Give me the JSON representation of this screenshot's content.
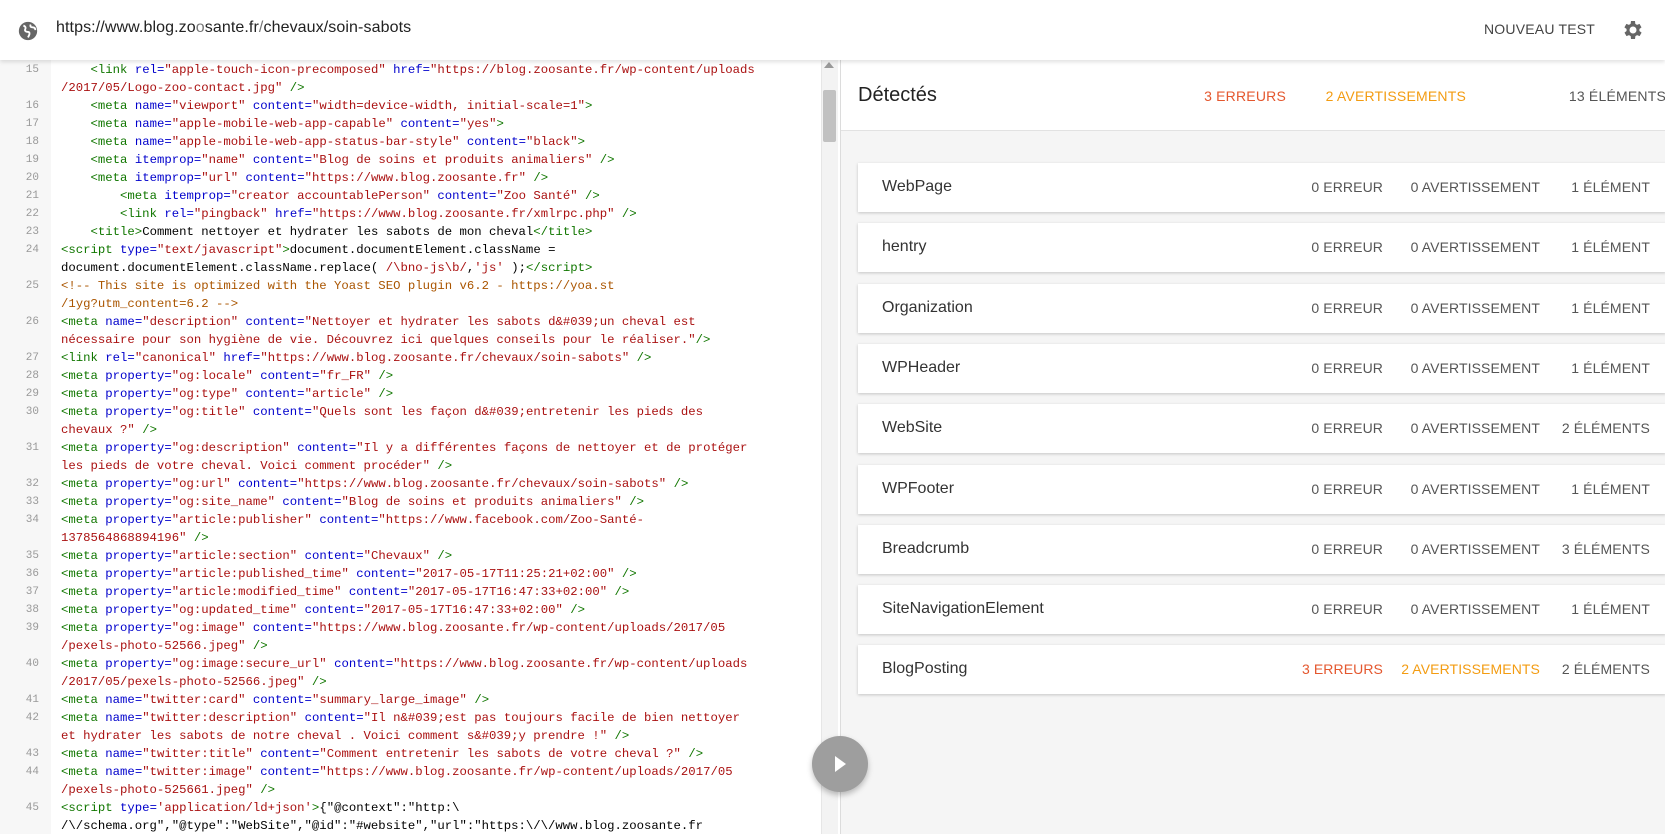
{
  "topbar": {
    "url_host_start": "https://www.blog.zo",
    "url_host_dim": "o",
    "url_host_end": "sante.fr",
    "url_path_dim": "/",
    "url_path": "chevaux/soin-sabots",
    "new_test_label": "NOUVEAU TEST",
    "globe_icon": "globe-icon",
    "settings_icon": "gear-icon"
  },
  "editor": {
    "lines": [
      {
        "n": "15",
        "html": "    <span class=\"t\">&lt;link</span> <span class=\"a\">rel=</span><span class=\"s\">\"apple-touch-icon-precomposed\"</span> <span class=\"a\">href=</span><span class=\"s\">\"https://blog.zoosante.fr/wp-content/uploads</span>"
      },
      {
        "n": "",
        "html": "<span class=\"s\">/2017/05/Logo-zoo-contact.jpg\"</span> <span class=\"t\">/&gt;</span>"
      },
      {
        "n": "16",
        "html": "    <span class=\"t\">&lt;meta</span> <span class=\"a\">name=</span><span class=\"s\">\"viewport\"</span> <span class=\"a\">content=</span><span class=\"s\">\"width=device-width, initial-scale=1\"</span><span class=\"t\">&gt;</span>"
      },
      {
        "n": "17",
        "html": "    <span class=\"t\">&lt;meta</span> <span class=\"a\">name=</span><span class=\"s\">\"apple-mobile-web-app-capable\"</span> <span class=\"a\">content=</span><span class=\"s\">\"yes\"</span><span class=\"t\">&gt;</span>"
      },
      {
        "n": "18",
        "html": "    <span class=\"t\">&lt;meta</span> <span class=\"a\">name=</span><span class=\"s\">\"apple-mobile-web-app-status-bar-style\"</span> <span class=\"a\">content=</span><span class=\"s\">\"black\"</span><span class=\"t\">&gt;</span>"
      },
      {
        "n": "19",
        "html": "    <span class=\"t\">&lt;meta</span> <span class=\"a\">itemprop=</span><span class=\"s\">\"name\"</span> <span class=\"a\">content=</span><span class=\"s\">\"Blog de soins et produits animaliers\"</span> <span class=\"t\">/&gt;</span>"
      },
      {
        "n": "20",
        "html": "    <span class=\"t\">&lt;meta</span> <span class=\"a\">itemprop=</span><span class=\"s\">\"url\"</span> <span class=\"a\">content=</span><span class=\"s\">\"https://www.blog.zoosante.fr\"</span> <span class=\"t\">/&gt;</span>"
      },
      {
        "n": "21",
        "html": "        <span class=\"t\">&lt;meta</span> <span class=\"a\">itemprop=</span><span class=\"s\">\"creator accountablePerson\"</span> <span class=\"a\">content=</span><span class=\"s\">\"Zoo Santé\"</span> <span class=\"t\">/&gt;</span>"
      },
      {
        "n": "22",
        "html": "        <span class=\"t\">&lt;link</span> <span class=\"a\">rel=</span><span class=\"s\">\"pingback\"</span> <span class=\"a\">href=</span><span class=\"s\">\"https://www.blog.zoosante.fr/xmlrpc.php\"</span> <span class=\"t\">/&gt;</span>"
      },
      {
        "n": "23",
        "html": "    <span class=\"t\">&lt;title&gt;</span>Comment nettoyer et hydrater les sabots de mon cheval<span class=\"t\">&lt;/title&gt;</span>"
      },
      {
        "n": "24",
        "html": "<span class=\"t\">&lt;script</span> <span class=\"a\">type=</span><span class=\"s\">\"text/javascript\"</span><span class=\"t\">&gt;</span>document.documentElement.className ="
      },
      {
        "n": "",
        "html": "document.documentElement.className.replace( <span class=\"s\">/\\bno-js\\b/</span>,<span class=\"s\">'js'</span> );<span class=\"t\">&lt;/script&gt;</span>"
      },
      {
        "n": "25",
        "html": "<span class=\"c\">&lt;!-- This site is optimized with the Yoast SEO plugin v6.2 - https://yoa.st</span>"
      },
      {
        "n": "",
        "html": "<span class=\"c\">/1yg?utm_content=6.2 --&gt;</span>"
      },
      {
        "n": "26",
        "html": "<span class=\"t\">&lt;meta</span> <span class=\"a\">name=</span><span class=\"s\">\"description\"</span> <span class=\"a\">content=</span><span class=\"s\">\"Nettoyer et hydrater les sabots d&amp;#039;un cheval est</span>"
      },
      {
        "n": "",
        "html": "<span class=\"s\">nécessaire pour son hygiène de vie. Découvrez ici quelques conseils pour le réaliser.\"</span><span class=\"t\">/&gt;</span>"
      },
      {
        "n": "27",
        "html": "<span class=\"t\">&lt;link</span> <span class=\"a\">rel=</span><span class=\"s\">\"canonical\"</span> <span class=\"a\">href=</span><span class=\"s\">\"https://www.blog.zoosante.fr/chevaux/soin-sabots\"</span> <span class=\"t\">/&gt;</span>"
      },
      {
        "n": "28",
        "html": "<span class=\"t\">&lt;meta</span> <span class=\"a\">property=</span><span class=\"s\">\"og:locale\"</span> <span class=\"a\">content=</span><span class=\"s\">\"fr_FR\"</span> <span class=\"t\">/&gt;</span>"
      },
      {
        "n": "29",
        "html": "<span class=\"t\">&lt;meta</span> <span class=\"a\">property=</span><span class=\"s\">\"og:type\"</span> <span class=\"a\">content=</span><span class=\"s\">\"article\"</span> <span class=\"t\">/&gt;</span>"
      },
      {
        "n": "30",
        "html": "<span class=\"t\">&lt;meta</span> <span class=\"a\">property=</span><span class=\"s\">\"og:title\"</span> <span class=\"a\">content=</span><span class=\"s\">\"Quels sont les façon d&amp;#039;entretenir les pieds des</span>"
      },
      {
        "n": "",
        "html": "<span class=\"s\">chevaux ?\"</span> <span class=\"t\">/&gt;</span>"
      },
      {
        "n": "31",
        "html": "<span class=\"t\">&lt;meta</span> <span class=\"a\">property=</span><span class=\"s\">\"og:description\"</span> <span class=\"a\">content=</span><span class=\"s\">\"Il y a différentes façons de nettoyer et de protéger</span>"
      },
      {
        "n": "",
        "html": "<span class=\"s\">les pieds de votre cheval. Voici comment procéder\"</span> <span class=\"t\">/&gt;</span>"
      },
      {
        "n": "32",
        "html": "<span class=\"t\">&lt;meta</span> <span class=\"a\">property=</span><span class=\"s\">\"og:url\"</span> <span class=\"a\">content=</span><span class=\"s\">\"https://www.blog.zoosante.fr/chevaux/soin-sabots\"</span> <span class=\"t\">/&gt;</span>"
      },
      {
        "n": "33",
        "html": "<span class=\"t\">&lt;meta</span> <span class=\"a\">property=</span><span class=\"s\">\"og:site_name\"</span> <span class=\"a\">content=</span><span class=\"s\">\"Blog de soins et produits animaliers\"</span> <span class=\"t\">/&gt;</span>"
      },
      {
        "n": "34",
        "html": "<span class=\"t\">&lt;meta</span> <span class=\"a\">property=</span><span class=\"s\">\"article:publisher\"</span> <span class=\"a\">content=</span><span class=\"s\">\"https://www.facebook.com/Zoo-Santé-</span>"
      },
      {
        "n": "",
        "html": "<span class=\"s\">1378564868894196\"</span> <span class=\"t\">/&gt;</span>"
      },
      {
        "n": "35",
        "html": "<span class=\"t\">&lt;meta</span> <span class=\"a\">property=</span><span class=\"s\">\"article:section\"</span> <span class=\"a\">content=</span><span class=\"s\">\"Chevaux\"</span> <span class=\"t\">/&gt;</span>"
      },
      {
        "n": "36",
        "html": "<span class=\"t\">&lt;meta</span> <span class=\"a\">property=</span><span class=\"s\">\"article:published_time\"</span> <span class=\"a\">content=</span><span class=\"s\">\"2017-05-17T11:25:21+02:00\"</span> <span class=\"t\">/&gt;</span>"
      },
      {
        "n": "37",
        "html": "<span class=\"t\">&lt;meta</span> <span class=\"a\">property=</span><span class=\"s\">\"article:modified_time\"</span> <span class=\"a\">content=</span><span class=\"s\">\"2017-05-17T16:47:33+02:00\"</span> <span class=\"t\">/&gt;</span>"
      },
      {
        "n": "38",
        "html": "<span class=\"t\">&lt;meta</span> <span class=\"a\">property=</span><span class=\"s\">\"og:updated_time\"</span> <span class=\"a\">content=</span><span class=\"s\">\"2017-05-17T16:47:33+02:00\"</span> <span class=\"t\">/&gt;</span>"
      },
      {
        "n": "39",
        "html": "<span class=\"t\">&lt;meta</span> <span class=\"a\">property=</span><span class=\"s\">\"og:image\"</span> <span class=\"a\">content=</span><span class=\"s\">\"https://www.blog.zoosante.fr/wp-content/uploads/2017/05</span>"
      },
      {
        "n": "",
        "html": "<span class=\"s\">/pexels-photo-52566.jpeg\"</span> <span class=\"t\">/&gt;</span>"
      },
      {
        "n": "40",
        "html": "<span class=\"t\">&lt;meta</span> <span class=\"a\">property=</span><span class=\"s\">\"og:image:secure_url\"</span> <span class=\"a\">content=</span><span class=\"s\">\"https://www.blog.zoosante.fr/wp-content/uploads</span>"
      },
      {
        "n": "",
        "html": "<span class=\"s\">/2017/05/pexels-photo-52566.jpeg\"</span> <span class=\"t\">/&gt;</span>"
      },
      {
        "n": "41",
        "html": "<span class=\"t\">&lt;meta</span> <span class=\"a\">name=</span><span class=\"s\">\"twitter:card\"</span> <span class=\"a\">content=</span><span class=\"s\">\"summary_large_image\"</span> <span class=\"t\">/&gt;</span>"
      },
      {
        "n": "42",
        "html": "<span class=\"t\">&lt;meta</span> <span class=\"a\">name=</span><span class=\"s\">\"twitter:description\"</span> <span class=\"a\">content=</span><span class=\"s\">\"Il n&amp;#039;est pas toujours facile de bien nettoyer</span>"
      },
      {
        "n": "",
        "html": "<span class=\"s\">et hydrater les sabots de notre cheval . Voici comment s&amp;#039;y prendre !\"</span> <span class=\"t\">/&gt;</span>"
      },
      {
        "n": "43",
        "html": "<span class=\"t\">&lt;meta</span> <span class=\"a\">name=</span><span class=\"s\">\"twitter:title\"</span> <span class=\"a\">content=</span><span class=\"s\">\"Comment entretenir les sabots de votre cheval ?\"</span> <span class=\"t\">/&gt;</span>"
      },
      {
        "n": "44",
        "html": "<span class=\"t\">&lt;meta</span> <span class=\"a\">name=</span><span class=\"s\">\"twitter:image\"</span> <span class=\"a\">content=</span><span class=\"s\">\"https://www.blog.zoosante.fr/wp-content/uploads/2017/05</span>"
      },
      {
        "n": "",
        "html": "<span class=\"s\">/pexels-photo-525661.jpeg\"</span> <span class=\"t\">/&gt;</span>"
      },
      {
        "n": "45",
        "html": "<span class=\"t\">&lt;script</span> <span class=\"a\">type=</span><span class=\"s\">'application/ld+json'</span><span class=\"t\">&gt;</span>{\"@context\":\"http:\\"
      },
      {
        "n": "",
        "html": "/\\/schema.org\",\"@type\":\"WebSite\",\"@id\":\"#website\",\"url\":\"https:\\/\\/www.blog.zoosante.fr"
      }
    ]
  },
  "results": {
    "title": "Détectés",
    "summary": {
      "errors": "3 ERREURS",
      "warnings": "2 AVERTISSEMENTS",
      "items": "13 ÉLÉMENTS"
    },
    "types": [
      {
        "name": "WebPage",
        "errors": "0 ERREUR",
        "warnings": "0 AVERTISSEMENT",
        "items": "1 ÉLÉMENT",
        "has_err": false
      },
      {
        "name": "hentry",
        "errors": "0 ERREUR",
        "warnings": "0 AVERTISSEMENT",
        "items": "1 ÉLÉMENT",
        "has_err": false
      },
      {
        "name": "Organization",
        "errors": "0 ERREUR",
        "warnings": "0 AVERTISSEMENT",
        "items": "1 ÉLÉMENT",
        "has_err": false
      },
      {
        "name": "WPHeader",
        "errors": "0 ERREUR",
        "warnings": "0 AVERTISSEMENT",
        "items": "1 ÉLÉMENT",
        "has_err": false
      },
      {
        "name": "WebSite",
        "errors": "0 ERREUR",
        "warnings": "0 AVERTISSEMENT",
        "items": "2 ÉLÉMENTS",
        "has_err": false
      },
      {
        "name": "WPFooter",
        "errors": "0 ERREUR",
        "warnings": "0 AVERTISSEMENT",
        "items": "1 ÉLÉMENT",
        "has_err": false
      },
      {
        "name": "Breadcrumb",
        "errors": "0 ERREUR",
        "warnings": "0 AVERTISSEMENT",
        "items": "3 ÉLÉMENTS",
        "has_err": false
      },
      {
        "name": "SiteNavigationElement",
        "errors": "0 ERREUR",
        "warnings": "0 AVERTISSEMENT",
        "items": "1 ÉLÉMENT",
        "has_err": false
      },
      {
        "name": "BlogPosting",
        "errors": "3 ERREURS",
        "warnings": "2 AVERTISSEMENTS",
        "items": "2 ÉLÉMENTS",
        "has_err": true
      }
    ]
  },
  "colors": {
    "error": "#e4572e",
    "warning": "#f39c12"
  },
  "play_icon": "play-icon"
}
